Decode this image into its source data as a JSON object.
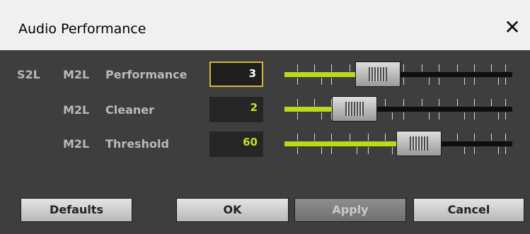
{
  "window": {
    "title": "Audio Performance",
    "close_glyph": "✕"
  },
  "rows": [
    {
      "prefix": "S2L",
      "mode": "M2L",
      "label": "Performance",
      "value": "3",
      "level": 0.32
    },
    {
      "prefix": "",
      "mode": "M2L",
      "label": "Cleaner",
      "value": "2",
      "level": 0.22
    },
    {
      "prefix": "",
      "mode": "M2L",
      "label": "Threshold",
      "value": "60",
      "level": 0.59
    }
  ],
  "buttons": {
    "defaults": "Defaults",
    "ok": "OK",
    "apply": "Apply",
    "cancel": "Cancel"
  },
  "colors": {
    "accent": "#b8dc1a",
    "value_text": "#c3e11f",
    "focus_border": "#d7b33c",
    "dialog_bg": "#3e3e3e"
  },
  "icons": {
    "close": "close-icon",
    "slider_grip": "grip-icon"
  }
}
